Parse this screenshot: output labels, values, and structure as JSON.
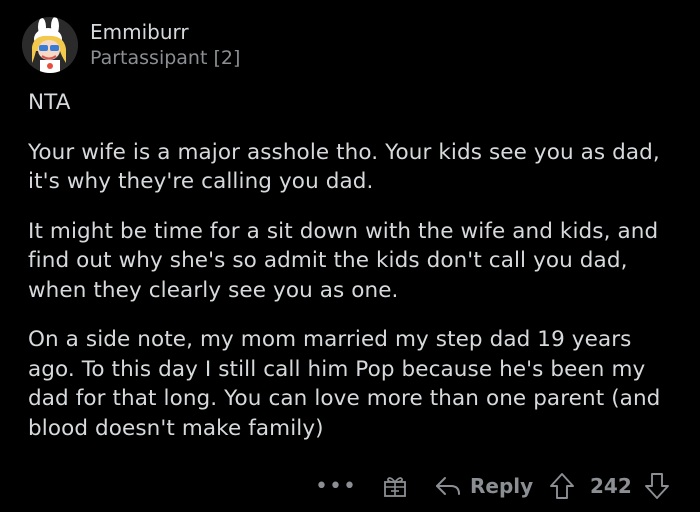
{
  "comment": {
    "author": "Emmiburr",
    "flair": "Partassipant [2]",
    "paragraphs": [
      "NTA",
      "Your wife is a major asshole tho. Your kids see you as dad, it's why they're calling you dad.",
      "It might be time for a sit down with the wife and kids, and find out why she's so admit the kids don't call you dad, when they clearly see you as one.",
      "On a side note, my mom married my step dad 19 years ago. To this day I still call him Pop because he's been my dad for that long. You can love more than one parent (and blood doesn't make family)"
    ]
  },
  "actions": {
    "more_label": "•••",
    "reply_label": "Reply",
    "score": "242",
    "icons": {
      "more": "more-options-icon",
      "award": "gift-award-icon",
      "reply": "reply-arrow-icon",
      "upvote": "upvote-arrow-icon",
      "downvote": "downvote-arrow-icon"
    }
  },
  "colors": {
    "background": "#000000",
    "text": "#d7dadc",
    "muted": "#8b8f93"
  }
}
